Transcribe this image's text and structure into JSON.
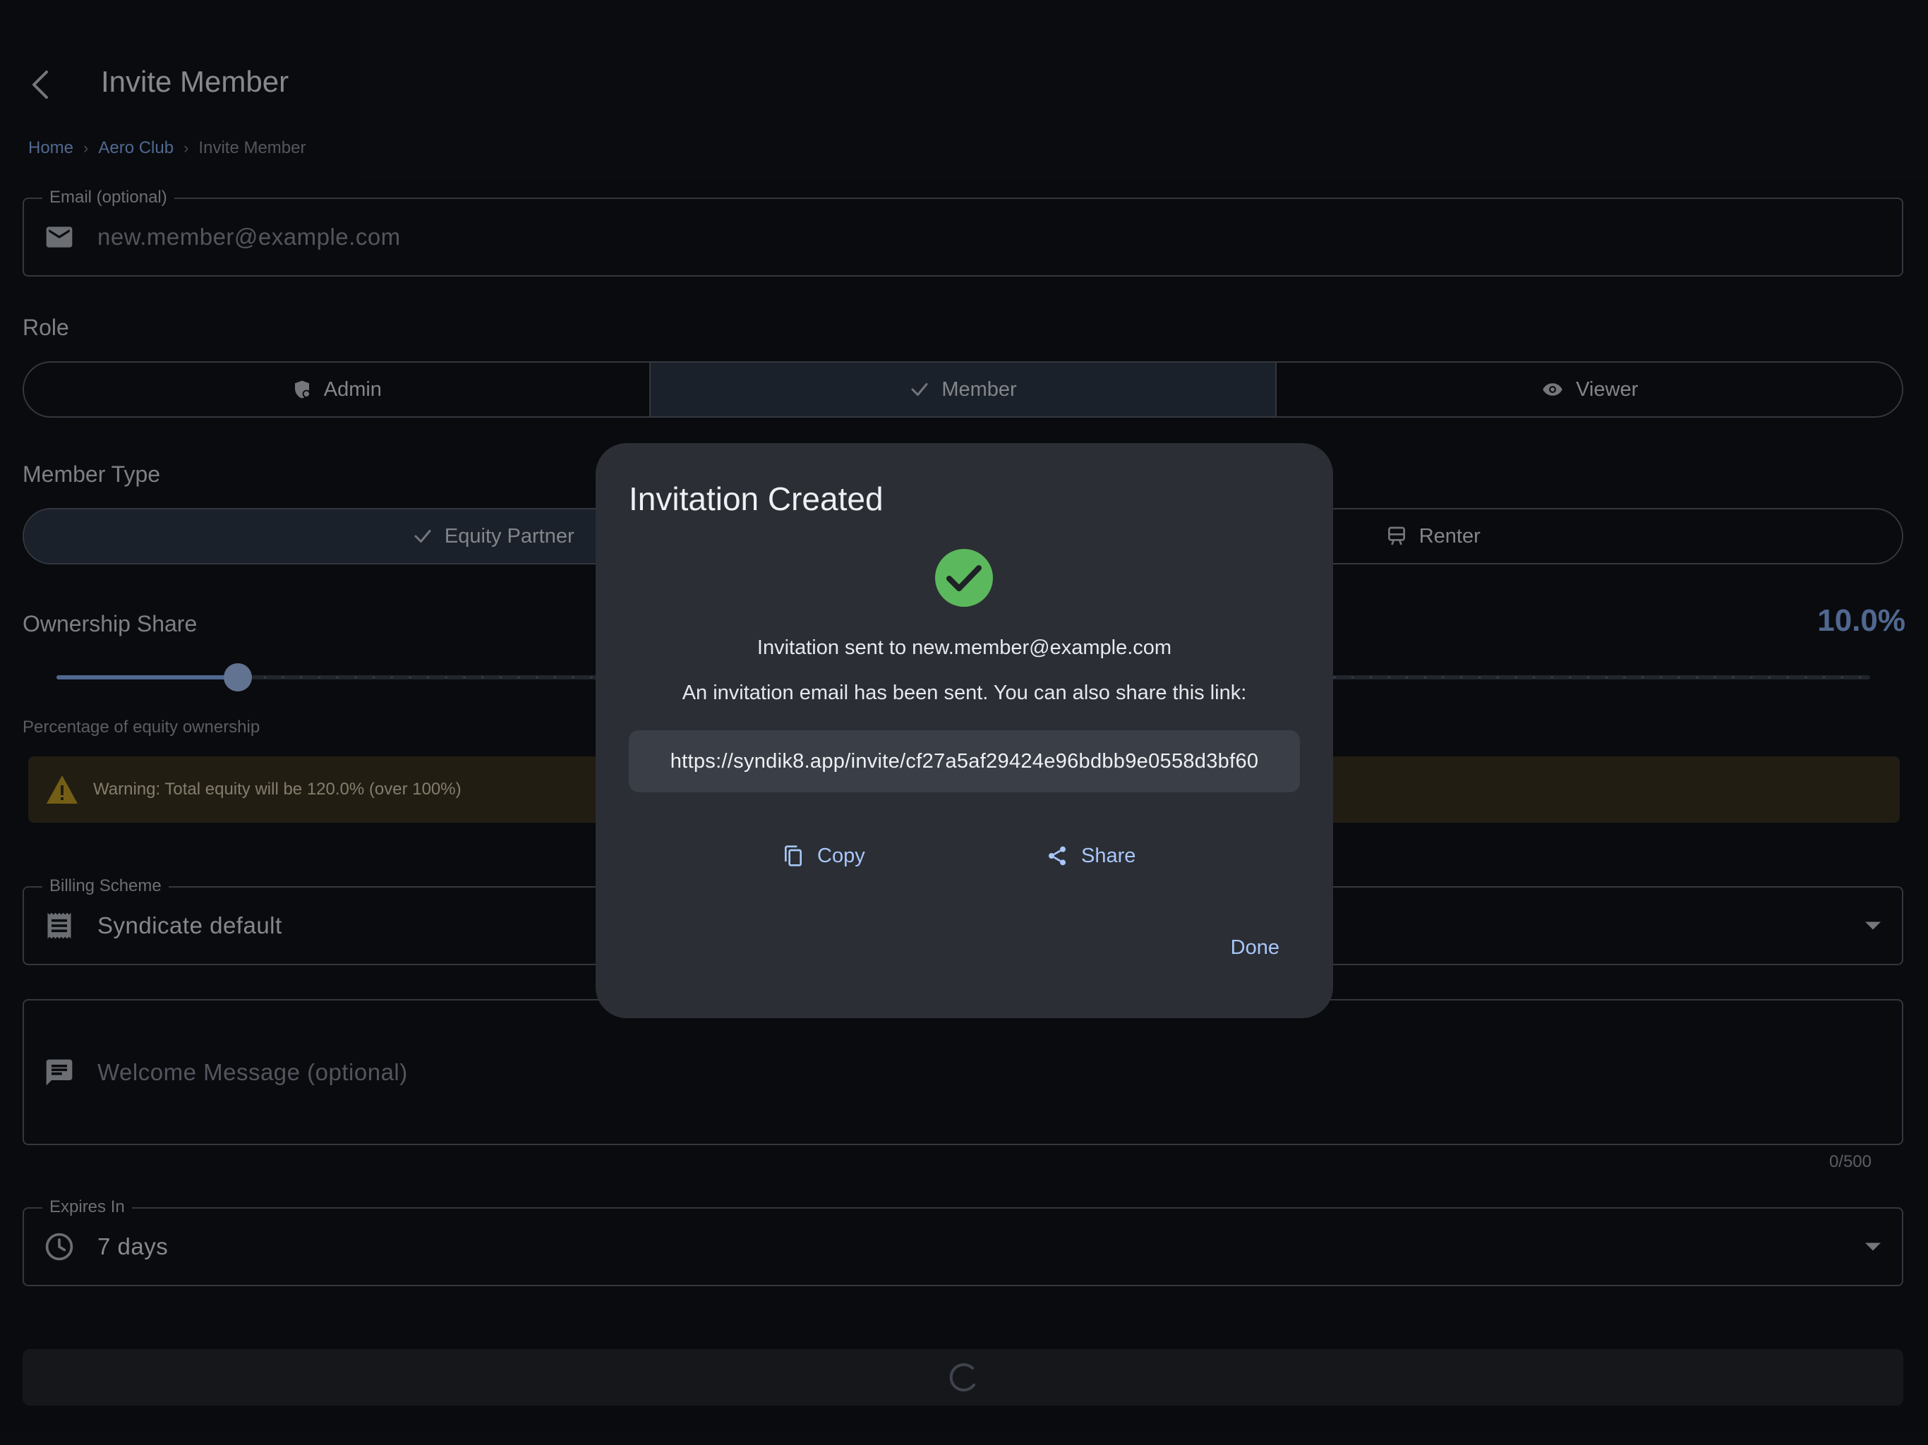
{
  "header": {
    "title": "Invite Member"
  },
  "breadcrumb": [
    {
      "label": "Home",
      "current": false
    },
    {
      "label": "Aero Club",
      "current": false
    },
    {
      "label": "Invite Member",
      "current": true
    }
  ],
  "email": {
    "legend": "Email (optional)",
    "value": "new.member@example.com"
  },
  "role": {
    "label": "Role",
    "options": [
      {
        "label": "Admin",
        "icon": "admin-shield-icon",
        "selected": false
      },
      {
        "label": "Member",
        "icon": "check-icon",
        "selected": true
      },
      {
        "label": "Viewer",
        "icon": "eye-icon",
        "selected": false
      }
    ]
  },
  "member_type": {
    "label": "Member Type",
    "options": [
      {
        "label": "Equity Partner",
        "icon": "check-icon",
        "selected": true
      },
      {
        "label": "Renter",
        "icon": "train-icon",
        "selected": false
      }
    ]
  },
  "ownership": {
    "label": "Ownership Share",
    "value_text": "10.0%",
    "value_fraction": 0.1,
    "helper": "Percentage of equity ownership"
  },
  "warning": {
    "text": "Warning: Total equity will be 120.0% (over 100%)"
  },
  "billing": {
    "legend": "Billing Scheme",
    "value": "Syndicate default"
  },
  "welcome": {
    "placeholder": "Welcome Message (optional)",
    "counter": "0/500"
  },
  "expires": {
    "legend": "Expires In",
    "value": "7 days"
  },
  "dialog": {
    "title": "Invitation Created",
    "sent_text": "Invitation sent to new.member@example.com",
    "info_text": "An invitation email has been sent. You can also share this link:",
    "link": "https://syndik8.app/invite/cf27a5af29424e96bdbb9e0558d3bf60",
    "copy_label": "Copy",
    "share_label": "Share",
    "done_label": "Done"
  },
  "colors": {
    "accent": "#8ab4f8",
    "success": "#5cb85c",
    "warning": "#c9a227",
    "background": "#121419",
    "dialog": "#2b2e34"
  }
}
